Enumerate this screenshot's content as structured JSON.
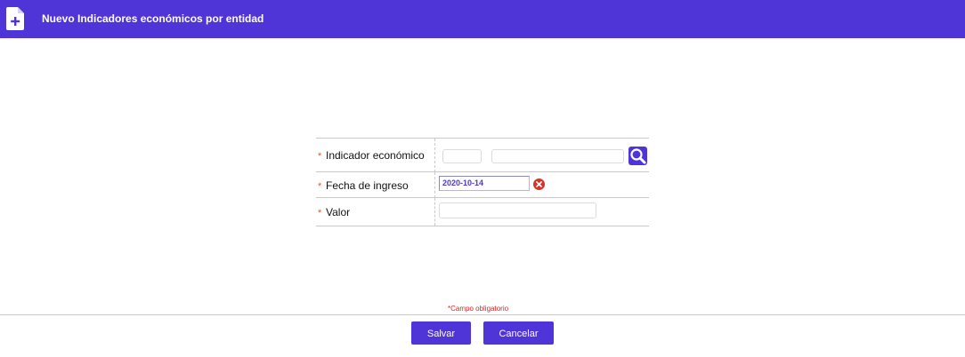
{
  "header": {
    "title": "Nuevo Indicadores económicos por entidad"
  },
  "form": {
    "required_marker": "*",
    "fields": [
      {
        "label": "Indicador económico",
        "code_value": "",
        "name_value": ""
      },
      {
        "label": "Fecha de ingreso",
        "value": "2020-10-14"
      },
      {
        "label": "Valor",
        "value": ""
      }
    ]
  },
  "footer": {
    "required_note": "*Campo obligatorio",
    "save_label": "Salvar",
    "cancel_label": "Cancelar"
  },
  "colors": {
    "accent": "#4f35d8",
    "required": "#e8542c",
    "clear": "#d8322a"
  },
  "icons": {
    "header": "file-plus-icon",
    "search": "search-icon",
    "clear": "clear-icon"
  }
}
